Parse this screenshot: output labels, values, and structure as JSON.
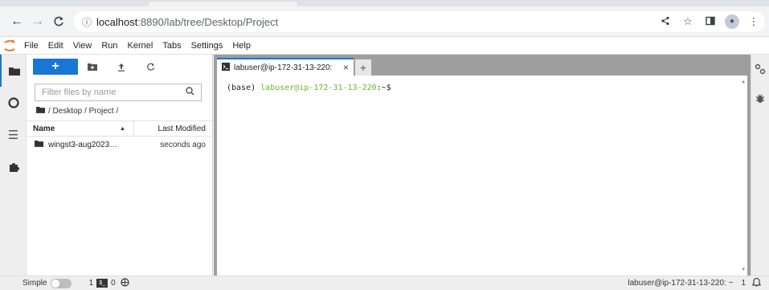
{
  "browser": {
    "url_host": "localhost",
    "url_path": ":8890/lab/tree/Desktop/Project",
    "info_icon": "info-icon"
  },
  "menu": [
    "File",
    "Edit",
    "View",
    "Run",
    "Kernel",
    "Tabs",
    "Settings",
    "Help"
  ],
  "filebrowser": {
    "new_label": "+",
    "filter_placeholder": "Filter files by name",
    "breadcrumb": "/ Desktop / Project /",
    "col_name": "Name",
    "col_modified": "Last Modified",
    "rows": [
      {
        "name": "wingst3-aug2023…",
        "modified": "seconds ago"
      }
    ]
  },
  "tab": {
    "label": "labuser@ip-172-31-13-220: ",
    "close": "×",
    "add": "+"
  },
  "terminal": {
    "env": "(base) ",
    "user": "labuser@ip-172-31-13-220",
    "suffix": ":~$"
  },
  "status": {
    "mode": "Simple",
    "count1": "1",
    "count2": "0",
    "right_text": "labuser@ip-172-31-13-220: ~",
    "right_count": "1"
  },
  "colors": {
    "accent": "#1976d2",
    "term_user": "#6ab825"
  }
}
